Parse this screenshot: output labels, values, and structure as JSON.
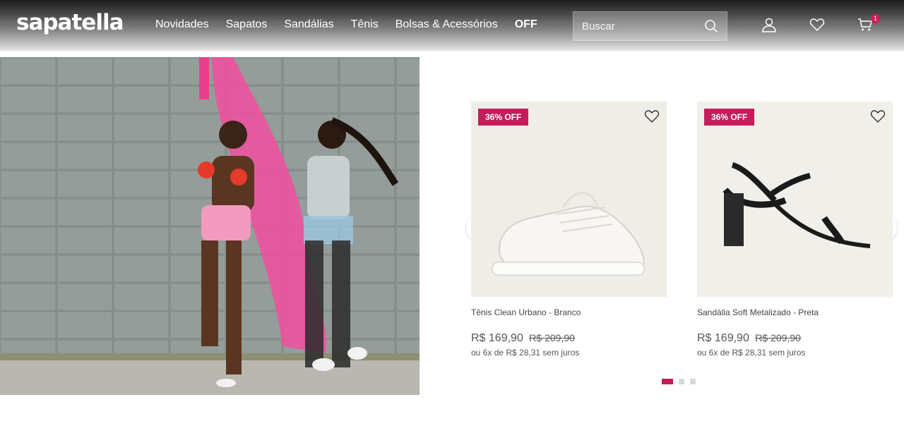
{
  "brand": {
    "logo": "sapatella"
  },
  "nav": {
    "items": [
      "Novidades",
      "Sapatos",
      "Sandálias",
      "Tênis",
      "Bolsas & Acessórios",
      "OFF"
    ]
  },
  "search": {
    "placeholder": "Buscar",
    "value": ""
  },
  "header_icons": [
    "account-icon",
    "wishlist-icon",
    "cart-icon"
  ],
  "cart": {
    "count": "1"
  },
  "hero": {
    "alt": "Duas mulheres posando com tecido rosa em frente a uma parede de blocos"
  },
  "products": [
    {
      "badge": "36% OFF",
      "name": "Tênis Clean Urbano - Branco",
      "price": "R$ 169,90",
      "old_price": "R$ 209,90",
      "installments": "ou 6x de R$ 28,31 sem juros"
    },
    {
      "badge": "36% OFF",
      "name": "Sandália Soft Metalizado - Preta",
      "price": "R$ 169,90",
      "old_price": "R$ 209,90",
      "installments": "ou 6x de R$ 28,31 sem juros"
    }
  ],
  "carousel": {
    "active_page": 1,
    "pages": 3
  },
  "colors": {
    "accent": "#c41d5a",
    "badge": "#c41d5a",
    "text": "#555555"
  }
}
